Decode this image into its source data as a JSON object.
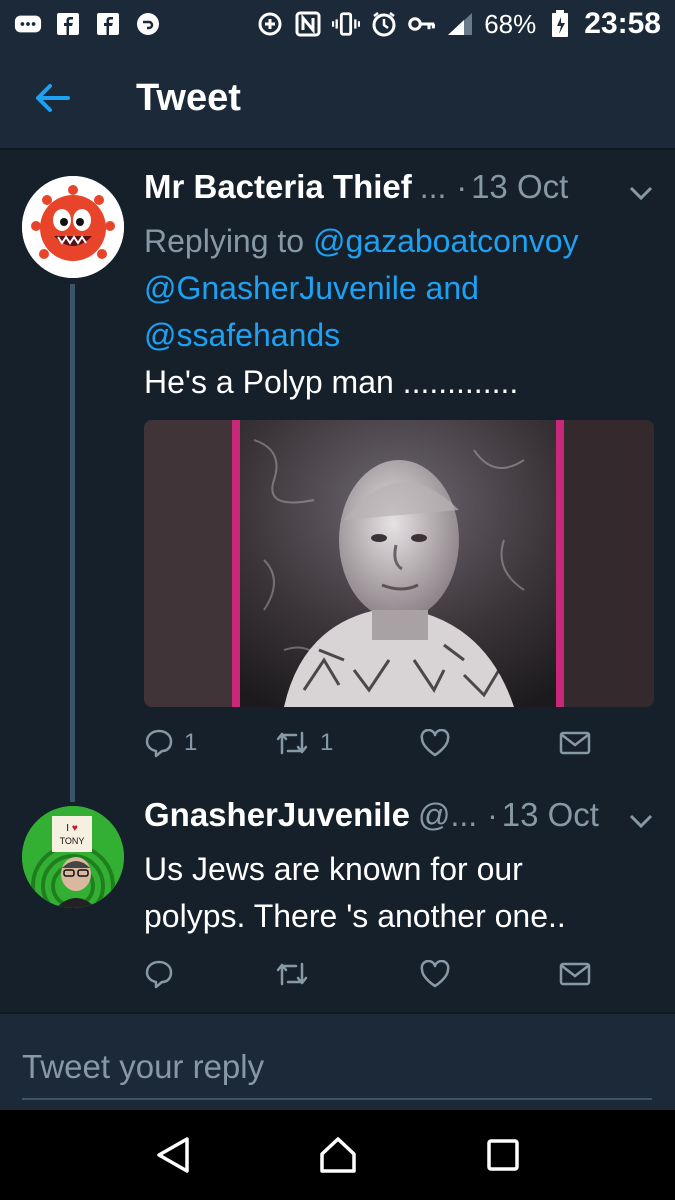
{
  "status_bar": {
    "battery": "68%",
    "time": "23:58",
    "icons": [
      "more-icon",
      "facebook-icon",
      "facebook-icon",
      "chat-icon",
      "data-saver-icon",
      "nfc-icon",
      "vibrate-icon",
      "alarm-icon",
      "key-icon",
      "signal-icon",
      "battery-icon"
    ]
  },
  "header": {
    "title": "Tweet",
    "back_icon": "back-arrow-icon"
  },
  "tweets": [
    {
      "name": "Mr Bacteria Thief",
      "handle": "...",
      "separator": "·",
      "date": "13 Oct",
      "replying_prefix": "Replying to",
      "mentions": [
        "@gazaboatconvoy",
        "@GnasherJuvenile",
        "@ssafehands"
      ],
      "mention_joiner": "and",
      "text": "He's a Polyp man .............",
      "counts": {
        "replies": "1",
        "retweets": "1"
      }
    },
    {
      "name": "GnasherJuvenile",
      "handle": "@...",
      "separator": "·",
      "date": "13 Oct",
      "text_line1": "Us Jews are known for our",
      "text_line2": "polyps. There 's another one..",
      "avatar_sign": "I ♥ TONY"
    }
  ],
  "reply": {
    "placeholder": "Tweet your reply"
  },
  "colors": {
    "background": "#15202b",
    "header": "#1c2938",
    "accent": "#1da1f2",
    "muted": "#8899a6"
  }
}
